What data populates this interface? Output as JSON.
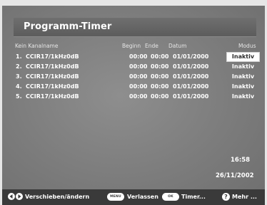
{
  "title": "Programm-Timer",
  "columns": {
    "channel": "Kein Kanalname",
    "begin": "Beginn",
    "end": "Ende",
    "date": "Datum",
    "mode": "Modus"
  },
  "rows": [
    {
      "num": "1.",
      "channel": "CCIR17/1kHz0dB",
      "begin": "00:00",
      "end": "00:00",
      "date": "01/01/2000",
      "mode": "Inaktiv"
    },
    {
      "num": "2.",
      "channel": "CCIR17/1kHz0dB",
      "begin": "00:00",
      "end": "00:00",
      "date": "01/01/2000",
      "mode": "Inaktiv"
    },
    {
      "num": "3.",
      "channel": "CCIR17/1kHz0dB",
      "begin": "00:00",
      "end": "00:00",
      "date": "01/01/2000",
      "mode": "Inaktiv"
    },
    {
      "num": "4.",
      "channel": "CCIR17/1kHz0dB",
      "begin": "00:00",
      "end": "00:00",
      "date": "01/01/2000",
      "mode": "Inaktiv"
    },
    {
      "num": "5.",
      "channel": "CCIR17/1kHz0dB",
      "begin": "00:00",
      "end": "00:00",
      "date": "01/01/2000",
      "mode": "Inaktiv"
    }
  ],
  "clock": {
    "time": "16:58",
    "date": "26/11/2002"
  },
  "footer": {
    "move_change": "Verschieben/ändern",
    "menu_key": "MENU",
    "exit": "Verlassen",
    "ok_key": "OK",
    "timer": "Timer...",
    "help_glyph": "?",
    "more": "Mehr ..."
  },
  "colors": {
    "screen_background": "#7c7c7c",
    "title_bar": "#5f5f5f",
    "footer_bar": "#3a3a3a",
    "selection_highlight": "#ffffff",
    "text": "#ffffff"
  },
  "icons": {
    "left_arrow": "arrow-left-icon",
    "right_arrow": "arrow-right-icon",
    "help": "help-icon"
  },
  "selected_row": 0
}
